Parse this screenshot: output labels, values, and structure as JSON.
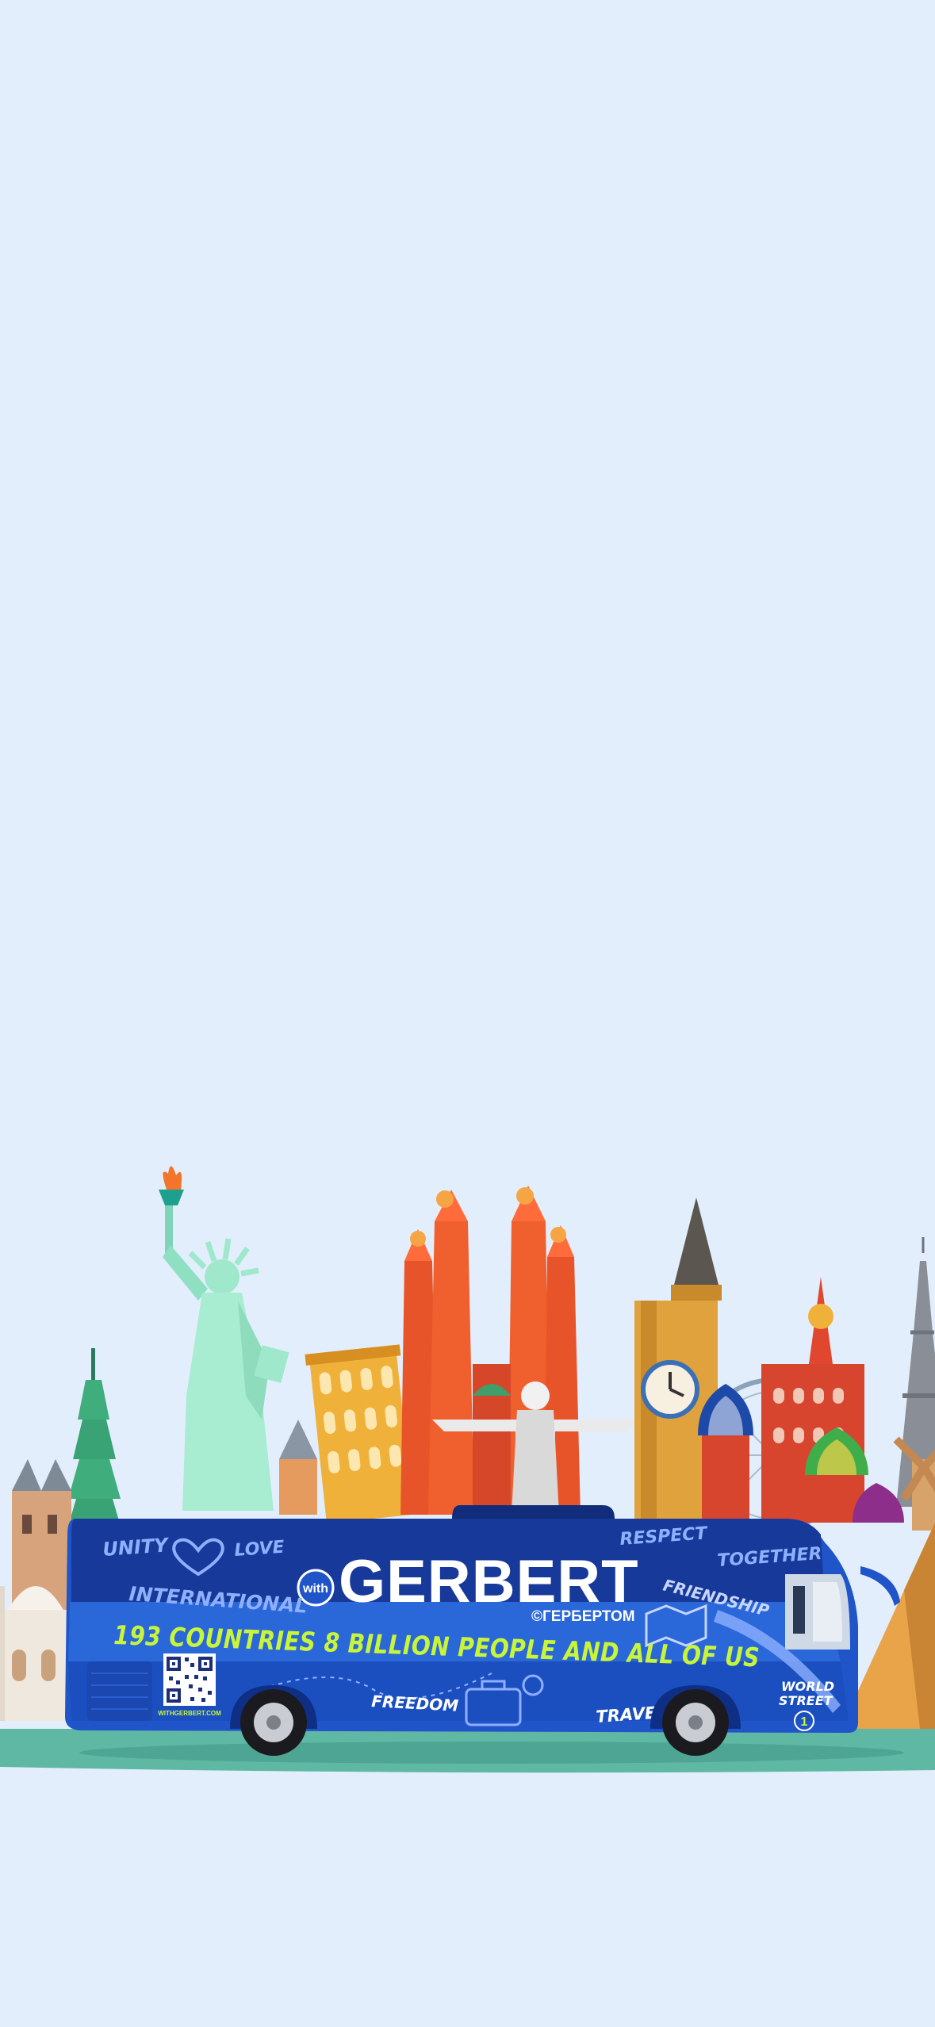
{
  "colors": {
    "background": "#e3eefc",
    "ground": "#5fb8a4",
    "bus_body": "#1f55c9",
    "bus_dark": "#173a9a",
    "slogan": "#c8f53a",
    "liberty": "#a8ecd2",
    "sagrada": "#e8542a",
    "bigben": "#e0a23c",
    "pisa": "#f0b13a"
  },
  "bus": {
    "badge": "with",
    "brand": "GERBERT",
    "brand_cyrillic": "©ГЕРБЕРТОМ",
    "slogan": "193 COUNTRIES 8 BILLION PEOPLE AND ALL OF US",
    "words": {
      "unity": "UNITY",
      "love": "LOVE",
      "respect": "RESPECT",
      "together": "TOGETHER",
      "international": "INTERNATIONAL",
      "friendship": "FRIENDSHIP",
      "freedom": "FREEDOM",
      "travel": "TRAVEL",
      "world_street_1": "WORLD",
      "world_street_2": "STREET",
      "world_street_number": "1"
    },
    "qr_caption": "WITHGERBERT.COM"
  },
  "landmarks": [
    "statue-of-liberty",
    "taipei-101",
    "leaning-tower-of-pisa",
    "sagrada-familia",
    "christ-the-redeemer",
    "big-ben",
    "st-basils-cathedral",
    "ferris-wheel",
    "eiffel-tower",
    "windmill",
    "pyramid",
    "taj-mahal"
  ]
}
